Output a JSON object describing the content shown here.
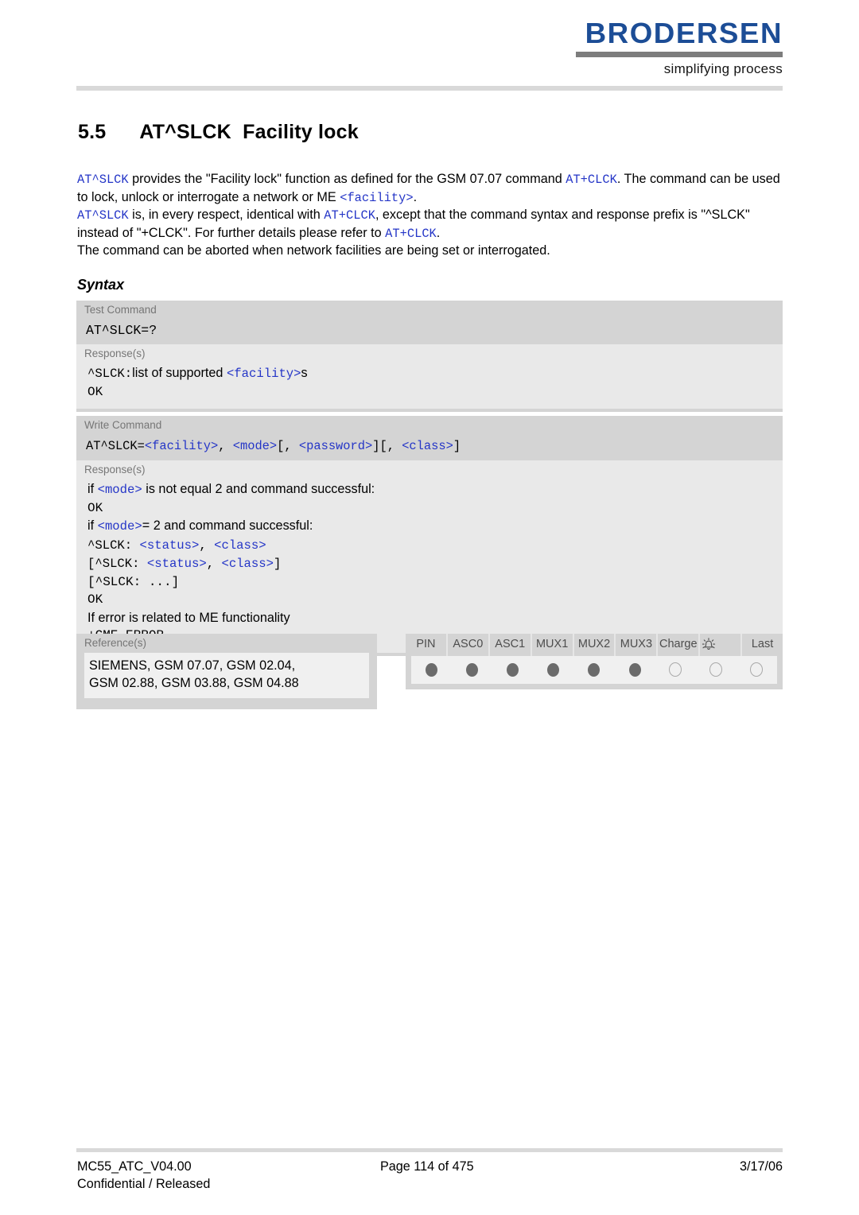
{
  "header": {
    "logo_word": "BRODERSEN",
    "logo_tagline": "simplifying process"
  },
  "title": {
    "number": "5.5",
    "command": "AT^SLCK",
    "name": "Facility lock"
  },
  "intro": {
    "p1_a": "AT^SLCK",
    "p1_b": " provides the \"Facility lock\" function as defined for the GSM 07.07 command ",
    "p1_c": "AT+CLCK",
    "p1_d": ". The command can be used to lock, unlock or interrogate a network or ME ",
    "p1_e": "<facility>",
    "p1_f": ".",
    "p2_a": "AT^SLCK",
    "p2_b": " is, in every respect, identical with ",
    "p2_c": "AT+CLCK",
    "p2_d": ", except that the command syntax and response prefix is \"^SLCK\" instead of \"+CLCK\". For further details please refer to ",
    "p2_e": "AT+CLCK",
    "p2_f": ".",
    "p3": "The command can be aborted when network facilities are being set or interrogated."
  },
  "syntax": {
    "heading": "Syntax",
    "test_command": {
      "label": "Test Command",
      "command": "AT^SLCK=?",
      "response_label": "Response(s)",
      "response_lines": [
        {
          "mono_prefix": "^SLCK:",
          "text": "list of supported ",
          "mono_blue": "<facility>",
          "suffix": "s"
        },
        {
          "plain_mono": "OK"
        }
      ]
    },
    "write_command": {
      "label": "Write Command",
      "command_parts": [
        {
          "t": "AT^SLCK=",
          "style": "mono"
        },
        {
          "t": "<facility>",
          "style": "mono-blue"
        },
        {
          "t": ", ",
          "style": "mono"
        },
        {
          "t": "<mode>",
          "style": "mono-blue"
        },
        {
          "t": "[, ",
          "style": "mono"
        },
        {
          "t": "<password>",
          "style": "mono-blue"
        },
        {
          "t": "][, ",
          "style": "mono"
        },
        {
          "t": "<class>",
          "style": "mono-blue"
        },
        {
          "t": "]",
          "style": "mono"
        }
      ],
      "response_label": "Response(s)",
      "lines": {
        "l1_a": "if ",
        "l1_b": "<mode>",
        "l1_c": " is not equal 2 and command successful:",
        "l2": "OK",
        "l3_a": "if ",
        "l3_b": "<mode>",
        "l3_c": "= 2 and command successful:",
        "l4_a": "^SLCK: ",
        "l4_b": "<status>",
        "l4_c": ", ",
        "l4_d": "<class>",
        "l5_a": "[^SLCK: ",
        "l5_b": "<status>",
        "l5_c": ", ",
        "l5_d": "<class>",
        "l5_e": "]",
        "l6": "[^SLCK: ...]",
        "l7": "OK",
        "l8": "If error is related to ME functionality",
        "l9": "+CME ERROR"
      }
    }
  },
  "references": {
    "label": "Reference(s)",
    "line1": "SIEMENS, GSM 07.07, GSM 02.04,",
    "line2": "GSM 02.88, GSM 03.88, GSM 04.88"
  },
  "pin_table": {
    "columns": [
      {
        "label": "PIN",
        "filled": true
      },
      {
        "label": "ASC0",
        "filled": true
      },
      {
        "label": "ASC1",
        "filled": true
      },
      {
        "label": "MUX1",
        "filled": true
      },
      {
        "label": "MUX2",
        "filled": true
      },
      {
        "label": "MUX3",
        "filled": true
      },
      {
        "label": "Charge",
        "filled": false
      },
      {
        "label": "",
        "icon": "alarm-bell-icon",
        "filled": false
      },
      {
        "label": "Last",
        "filled": false
      }
    ]
  },
  "footer": {
    "left_line1": "MC55_ATC_V04.00",
    "left_line2": "Confidential / Released",
    "center": "Page 114 of 475",
    "right": "3/17/06"
  },
  "colors": {
    "brand_blue": "#1c4d96",
    "code_blue": "#2435c7",
    "block_gray": "#d4d4d4",
    "response_gray": "#e9e9e9",
    "inner_gray": "#f0f0f0"
  }
}
